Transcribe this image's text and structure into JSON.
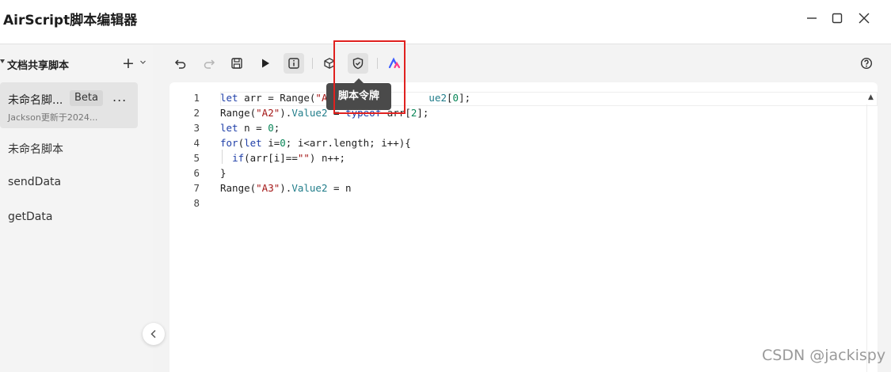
{
  "window": {
    "title": "AirScript脚本编辑器"
  },
  "sidebar": {
    "header": "文档共享脚本",
    "add_label": "+",
    "active_script": {
      "name": "未命名脚...",
      "badge": "Beta",
      "more": "...",
      "subtitle": "Jackson更新于2024..."
    },
    "scripts": [
      "未命名脚本",
      "sendData",
      "getData"
    ]
  },
  "toolbar": {
    "icons": [
      "undo-icon",
      "redo-icon",
      "save-icon",
      "run-icon",
      "info-icon",
      "package-icon",
      "shield-icon",
      "ai-logo-icon",
      "help-icon"
    ]
  },
  "tooltip": {
    "text": "脚本令牌"
  },
  "editor": {
    "line_numbers": [
      "1",
      "2",
      "3",
      "4",
      "5",
      "6",
      "7",
      "8"
    ],
    "visible_fragments": {
      "line1_a": "let arr = Range(\"A",
      "line1_b": "ue2[0];",
      "line2_a": "Range(\"A2\").Value2 = typeof arr[2];"
    }
  },
  "watermark": "CSDN @jackispy",
  "colors": {
    "highlight": "#e0211f",
    "tooltip_bg": "#4a4a4a",
    "keyword": "#1f3fa8",
    "string": "#a31515",
    "number": "#098658"
  }
}
